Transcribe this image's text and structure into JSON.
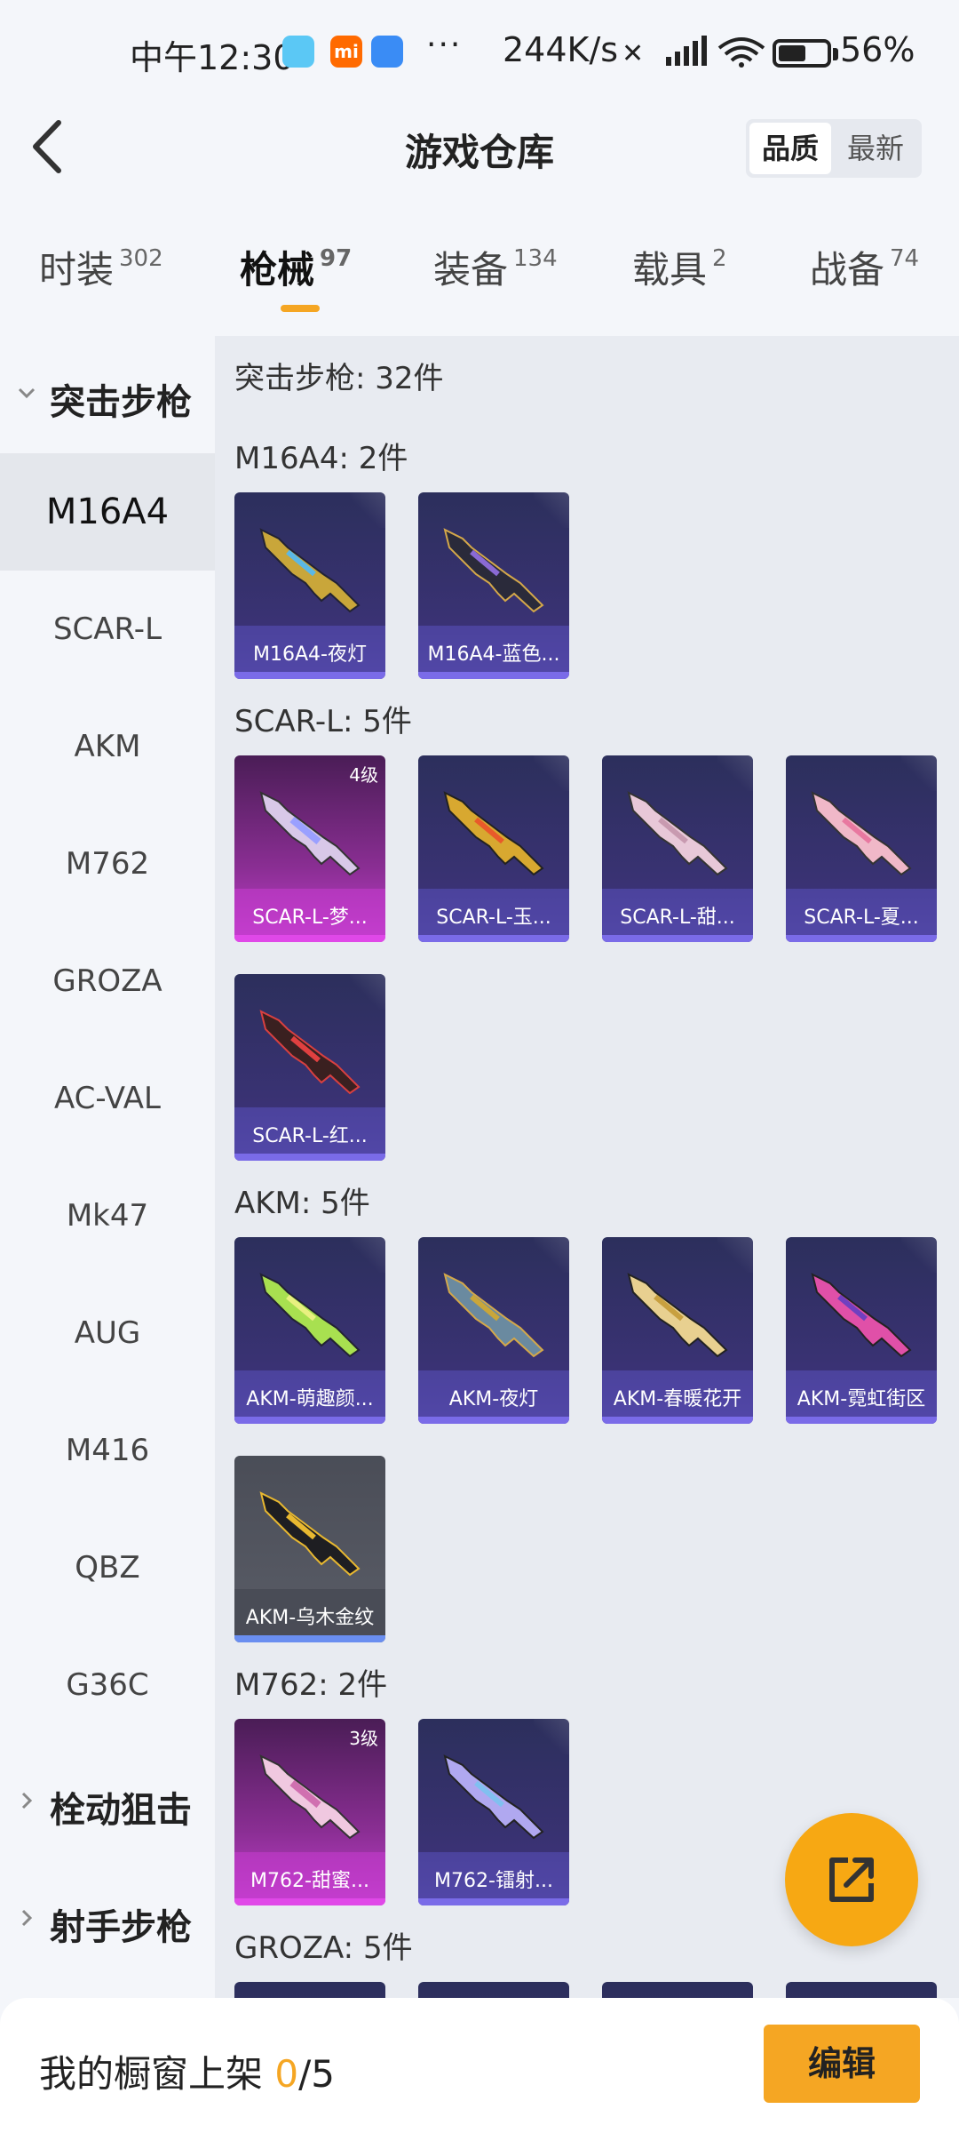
{
  "status_bar": {
    "time": "中午12:30",
    "app_badge": "mi",
    "more": "···",
    "network_speed": "244K/s",
    "battery_percent": "56%"
  },
  "header": {
    "title": "游戏仓库",
    "sort_options": [
      "品质",
      "最新"
    ],
    "sort_selected": "品质"
  },
  "tabs": [
    {
      "label": "时装",
      "count": "302"
    },
    {
      "label": "枪械",
      "count": "97"
    },
    {
      "label": "装备",
      "count": "134"
    },
    {
      "label": "载具",
      "count": "2"
    },
    {
      "label": "战备",
      "count": "74"
    }
  ],
  "active_tab": "枪械",
  "sidebar": {
    "categories": [
      {
        "label": "突击步枪",
        "expanded": true
      },
      {
        "label": "栓动狙击",
        "expanded": false
      },
      {
        "label": "射手步枪",
        "expanded": false
      }
    ],
    "subitems": [
      "M16A4",
      "SCAR-L",
      "AKM",
      "M762",
      "GROZA",
      "AC-VAL",
      "Mk47",
      "AUG",
      "M416",
      "QBZ",
      "G36C"
    ],
    "active_subitem": "M16A4"
  },
  "main": {
    "summary": "突击步枪: 32件",
    "groups": [
      {
        "title": "M16A4: 2件",
        "items": [
          {
            "name": "M16A4-夜灯",
            "rarity": "purple",
            "level": ""
          },
          {
            "name": "M16A4-蓝色...",
            "rarity": "purple",
            "level": ""
          }
        ]
      },
      {
        "title": "SCAR-L: 5件",
        "items": [
          {
            "name": "SCAR-L-梦...",
            "rarity": "pink",
            "level": "4级"
          },
          {
            "name": "SCAR-L-玉...",
            "rarity": "purple",
            "level": ""
          },
          {
            "name": "SCAR-L-甜...",
            "rarity": "purple",
            "level": ""
          },
          {
            "name": "SCAR-L-夏...",
            "rarity": "purple",
            "level": ""
          },
          {
            "name": "SCAR-L-红...",
            "rarity": "purple",
            "level": ""
          }
        ]
      },
      {
        "title": "AKM: 5件",
        "items": [
          {
            "name": "AKM-萌趣颜...",
            "rarity": "purple",
            "level": ""
          },
          {
            "name": "AKM-夜灯",
            "rarity": "purple",
            "level": ""
          },
          {
            "name": "AKM-春暖花开",
            "rarity": "purple",
            "level": ""
          },
          {
            "name": "AKM-霓虹街区",
            "rarity": "purple",
            "level": ""
          },
          {
            "name": "AKM-乌木金纹",
            "rarity": "gray",
            "level": ""
          }
        ]
      },
      {
        "title": "M762: 2件",
        "items": [
          {
            "name": "M762-甜蜜...",
            "rarity": "pink",
            "level": "3级"
          },
          {
            "name": "M762-镭射...",
            "rarity": "purple",
            "level": ""
          }
        ]
      },
      {
        "title": "GROZA: 5件",
        "items": []
      }
    ]
  },
  "bottom_bar": {
    "label": "我的橱窗上架 ",
    "count": "0",
    "total": "/5",
    "edit_label": "编辑"
  },
  "colors": {
    "accent": "#f5a623",
    "card_purple": "#3a3274",
    "card_pink": "#8a2e93",
    "card_gray": "#5a5d67"
  }
}
